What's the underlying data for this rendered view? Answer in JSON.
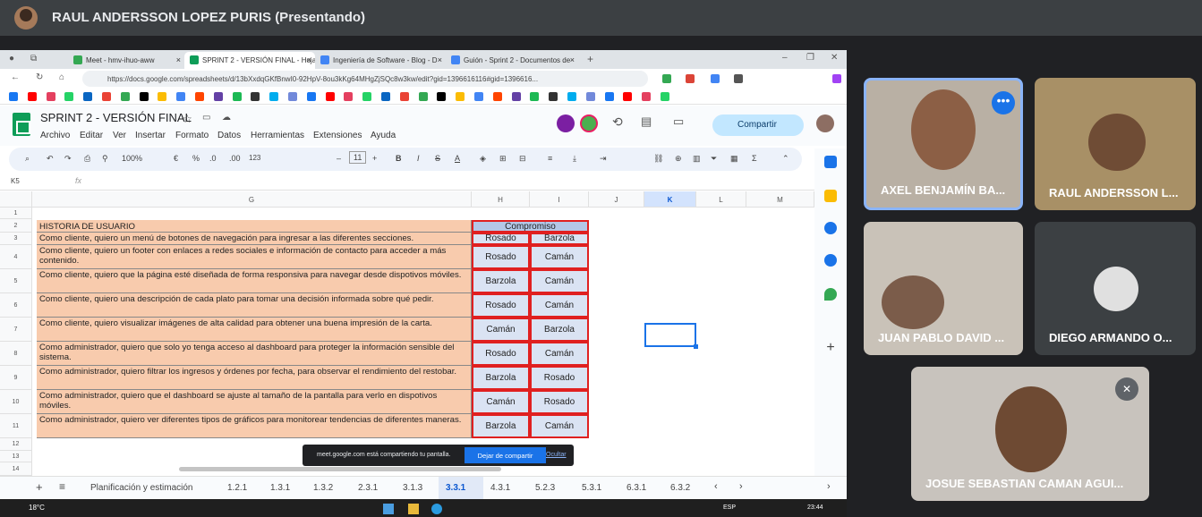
{
  "meet": {
    "presenter_label": "RAUL ANDERSSON LOPEZ PURIS (Presentando)",
    "participants": [
      {
        "name": "AXEL BENJAMÍN BA..."
      },
      {
        "name": "RAUL ANDERSSON L..."
      },
      {
        "name": "JUAN PABLO DAVID ..."
      },
      {
        "name": "DIEGO ARMANDO O..."
      },
      {
        "name": "JOSUE SEBASTIAN CAMAN AGUI..."
      }
    ],
    "toast": {
      "message": "meet.google.com está compartiendo tu pantalla.",
      "stop": "Dejar de compartir",
      "hide": "Ocultar"
    }
  },
  "browser": {
    "tabs": [
      {
        "title": "Meet - hmv-ihuo-aww",
        "color": "#34a853"
      },
      {
        "title": "SPRINT 2 - VERSIÓN FINAL - Hoja",
        "color": "#0f9d58"
      },
      {
        "title": "Ingeniería de Software - Blog - D",
        "color": "#4285f4"
      },
      {
        "title": "Guión - Sprint 2 - Documentos de",
        "color": "#4285f4"
      }
    ],
    "url": "https://docs.google.com/spreadsheets/d/13bXxdqGKfBnwI0-92HpV-8ou3kKg64MHgZjSQc8w3kw/edit?gid=1396616116#gid=1396616..."
  },
  "sheet": {
    "title": "SPRINT 2 - VERSIÓN FINAL",
    "menu": [
      "Archivo",
      "Editar",
      "Ver",
      "Insertar",
      "Formato",
      "Datos",
      "Herramientas",
      "Extensiones",
      "Ayuda"
    ],
    "share_label": "Compartir",
    "toolbar": {
      "zoom": "100%",
      "currency": "€",
      "percent": "%",
      "dec_less": ".0",
      "dec_more": ".00",
      "numfmt": "123",
      "fontsize": "11",
      "bold": "B",
      "italic": "I",
      "sum": "Σ"
    },
    "cell_ref": "K5",
    "fx": "fx",
    "columns": [
      "G",
      "H",
      "I",
      "J",
      "K",
      "L",
      "M"
    ],
    "rows": [
      "1",
      "2",
      "3",
      "4",
      "5",
      "6",
      "7",
      "8",
      "9",
      "10",
      "11",
      "12",
      "13",
      "14"
    ],
    "header_story": "HISTORIA DE USUARIO",
    "header_commit": "Compromiso",
    "stories": [
      {
        "text": "Como cliente, quiero un menú de botones de navegación para ingresar a las diferentes secciones.",
        "a": "Rosado",
        "b": "Barzola"
      },
      {
        "text": "Como cliente, quiero un footer con enlaces a redes sociales e información de contacto para acceder a más contenido.",
        "a": "Rosado",
        "b": "Camán"
      },
      {
        "text": "Como cliente, quiero que la página esté diseñada de forma responsiva para navegar desde dispotivos móviles.",
        "a": "Barzola",
        "b": "Camán"
      },
      {
        "text": "Como cliente, quiero una descripción de cada plato para tomar una decisión informada sobre qué pedir.",
        "a": "Rosado",
        "b": "Camán"
      },
      {
        "text": "Como cliente, quiero visualizar imágenes de alta calidad para obtener una buena impresión de la carta.",
        "a": "Camán",
        "b": "Barzola"
      },
      {
        "text": "Como administrador, quiero que solo yo tenga acceso al dashboard para proteger la información sensible del sistema.",
        "a": "Rosado",
        "b": "Camán"
      },
      {
        "text": "Como administrador, quiero filtrar los ingresos y órdenes por fecha, para observar el rendimiento del restobar.",
        "a": "Barzola",
        "b": "Rosado"
      },
      {
        "text": "Como administrador, quiero que el dashboard se ajuste al tamaño de la pantalla para verlo en dispotivos móviles.",
        "a": "Camán",
        "b": "Rosado"
      },
      {
        "text": "Como administrador, quiero ver diferentes tipos de gráficos para monitorear tendencias de diferentes maneras.",
        "a": "Barzola",
        "b": "Camán"
      }
    ],
    "sheet_tabs": [
      "Planificación y estimación",
      "1.2.1",
      "1.3.1",
      "1.3.2",
      "2.3.1",
      "3.1.3",
      "3.3.1",
      "4.3.1",
      "5.2.3",
      "5.3.1",
      "6.3.1",
      "6.3.2"
    ]
  },
  "taskbar": {
    "weather": "18°C",
    "lang": "ESP",
    "time": "23:44"
  }
}
